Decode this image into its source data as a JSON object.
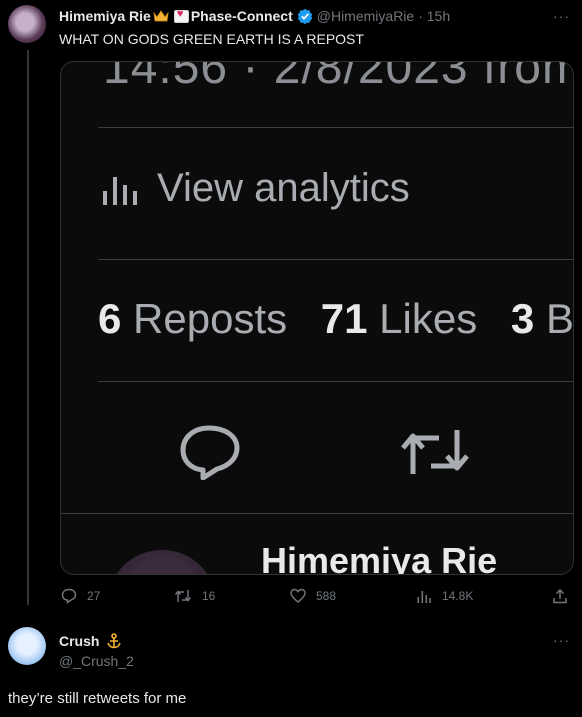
{
  "post": {
    "author_name": "Himemiya Rie",
    "affiliation": "Phase-Connect",
    "handle": "@HimemiyaRie",
    "time": "· 15h",
    "text": "WHAT ON GODS GREEN EARTH IS A REPOST",
    "more": "···"
  },
  "embedded_screenshot": {
    "timestamp_fragment": "14:56 · 2/8/2023 from",
    "view_analytics_label": "View analytics",
    "reposts_count": "6",
    "reposts_label": "Reposts",
    "likes_count": "71",
    "likes_label": "Likes",
    "bookmarks_count": "3",
    "bookmarks_label_fragment": "B",
    "author_name_fragment": "Himemiya Rie"
  },
  "actions": {
    "replies": "27",
    "reposts": "16",
    "likes": "588",
    "views": "14.8K"
  },
  "reply": {
    "author_name": "Crush",
    "handle": "@_Crush_2",
    "text": "they’re still retweets for me",
    "more": "···"
  },
  "icons": [
    "crown-icon",
    "heart-badge-icon",
    "verified-badge-icon",
    "more-icon",
    "bar-chart-icon",
    "reply-icon",
    "repost-icon",
    "like-icon",
    "views-icon",
    "share-icon",
    "anchor-icon"
  ],
  "colors": {
    "background": "#000000",
    "text": "#e7e9ea",
    "muted": "#71767b",
    "verified": "#1d9bf0",
    "divider": "#2f3336"
  }
}
